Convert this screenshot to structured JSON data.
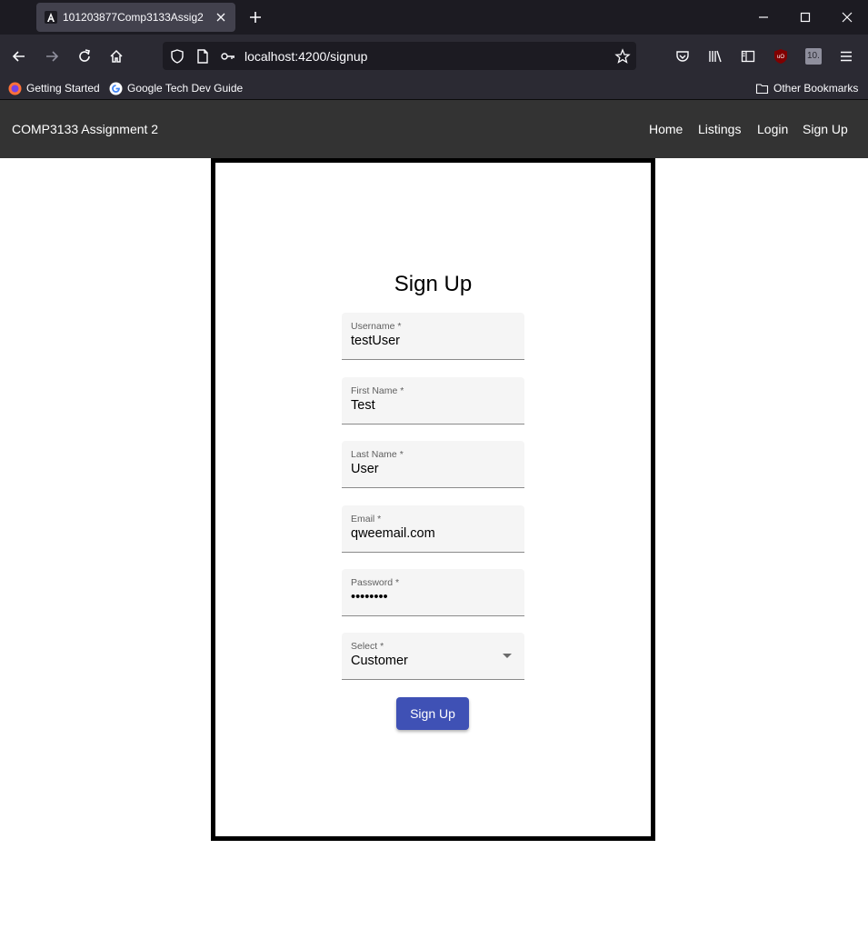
{
  "browser": {
    "tab_title": "101203877Comp3133Assig2",
    "url": "localhost:4200/signup",
    "bookmarks": [
      {
        "label": "Getting Started",
        "icon": "firefox-icon"
      },
      {
        "label": "Google Tech Dev Guide",
        "icon": "google-icon"
      }
    ],
    "other_bookmarks": "Other Bookmarks",
    "extension_badge": "10."
  },
  "app": {
    "title": "COMP3133 Assignment 2",
    "nav": [
      "Home",
      "Listings",
      "Login",
      "Sign Up"
    ]
  },
  "form": {
    "title": "Sign Up",
    "fields": [
      {
        "label": "Username *",
        "value": "testUser"
      },
      {
        "label": "First Name *",
        "value": "Test"
      },
      {
        "label": "Last Name *",
        "value": "User"
      },
      {
        "label": "Email *",
        "value": "qweemail.com"
      },
      {
        "label": "Password *",
        "value": "••••••••"
      },
      {
        "label": "Select *",
        "value": "Customer"
      }
    ],
    "submit_label": "Sign Up"
  },
  "colors": {
    "toolbar": "#333333",
    "primary_button": "#3f51b5",
    "field_bg": "#f5f5f5"
  }
}
